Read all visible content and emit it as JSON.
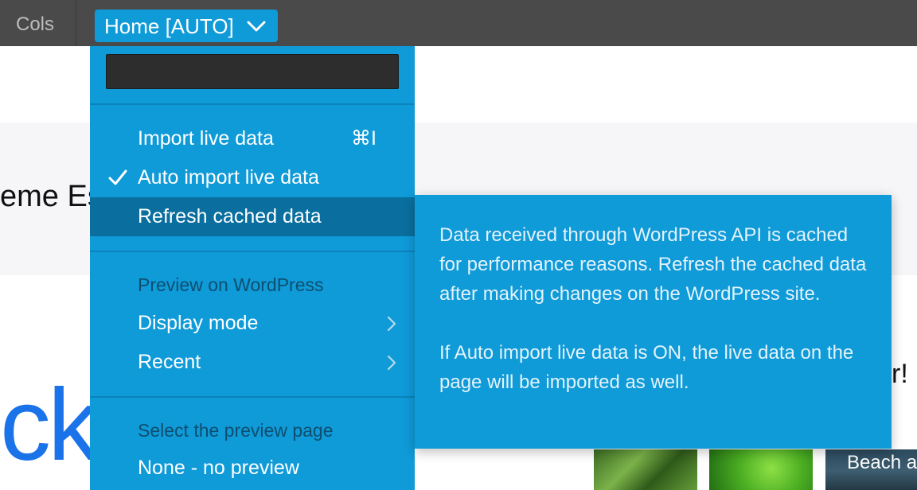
{
  "toolbar": {
    "cols_label": "Cols",
    "page_select_label": "Home [AUTO]"
  },
  "page_background": {
    "heading_fragment": "eme Es",
    "big_word_fragment": "ck",
    "cta_fragment": "r!",
    "thumbnail_caption": "Beach at Big"
  },
  "menu": {
    "search_value": "",
    "items_top": [
      {
        "label": "Import live data",
        "shortcut": "⌘I",
        "checked": false
      },
      {
        "label": "Auto import live data",
        "checked": true
      },
      {
        "label": "Refresh cached data",
        "highlighted": true
      }
    ],
    "preview_section_label": "Preview on WordPress",
    "preview_items": [
      {
        "label": "Display mode",
        "has_submenu": true
      },
      {
        "label": "Recent",
        "has_submenu": true
      }
    ],
    "select_page_label": "Select the preview page",
    "page_items": [
      {
        "label": "None - no preview"
      }
    ]
  },
  "tooltip": {
    "paragraph_1": "Data received through WordPress API is cached for performance reasons. Refresh the cached data after making changes on the WordPress site.",
    "paragraph_2": "If Auto import live data is ON, the live data on the page will be imported as well."
  },
  "colors": {
    "toolbar_bg": "#4a4a4a",
    "menu_bg": "#0f9ad8",
    "menu_highlight": "#0a6f9e",
    "section_label": "#0d4f70",
    "link_blue": "#1a73e8"
  }
}
